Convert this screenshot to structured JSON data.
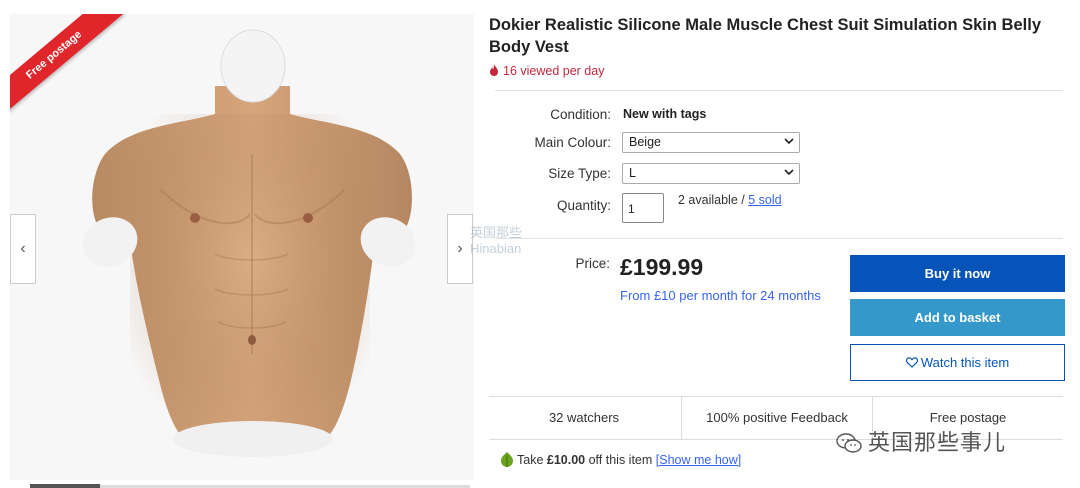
{
  "gallery": {
    "ribbon_text": "Free postage",
    "prev_arrow": "‹",
    "next_arrow": "›"
  },
  "listing": {
    "title": "Dokier Realistic Silicone Male Muscle Chest Suit Simulation Skin Belly Body Vest",
    "viewed": "16 viewed per day"
  },
  "details": {
    "condition_label": "Condition:",
    "condition_value": "New with tags",
    "colour_label": "Main Colour:",
    "colour_value": "Beige",
    "size_label": "Size Type:",
    "size_value": "L",
    "quantity_label": "Quantity:",
    "quantity_value": "1",
    "available_text": "2 available / ",
    "sold_text": "5 sold"
  },
  "pricing": {
    "price_label": "Price:",
    "price": "£199.99",
    "monthly": "From £10 per month for 24 months"
  },
  "actions": {
    "buy_now": "Buy it now",
    "add_basket": "Add to basket",
    "watch": "Watch this item"
  },
  "stats": {
    "watchers": "32 watchers",
    "feedback": "100% positive Feedback",
    "postage": "Free postage"
  },
  "offer": {
    "text_prefix": "Take ",
    "amount": "£10.00",
    "text_suffix": " off this item ",
    "link": "[Show me how]"
  },
  "watermark": {
    "text": "英国那些事儿",
    "mid_line1": "英国那些",
    "mid_line2": "Hinabian"
  },
  "colors": {
    "accent": "#0654ba",
    "basket": "#3498ca",
    "link": "#3665f3",
    "alert": "#c5283d"
  }
}
